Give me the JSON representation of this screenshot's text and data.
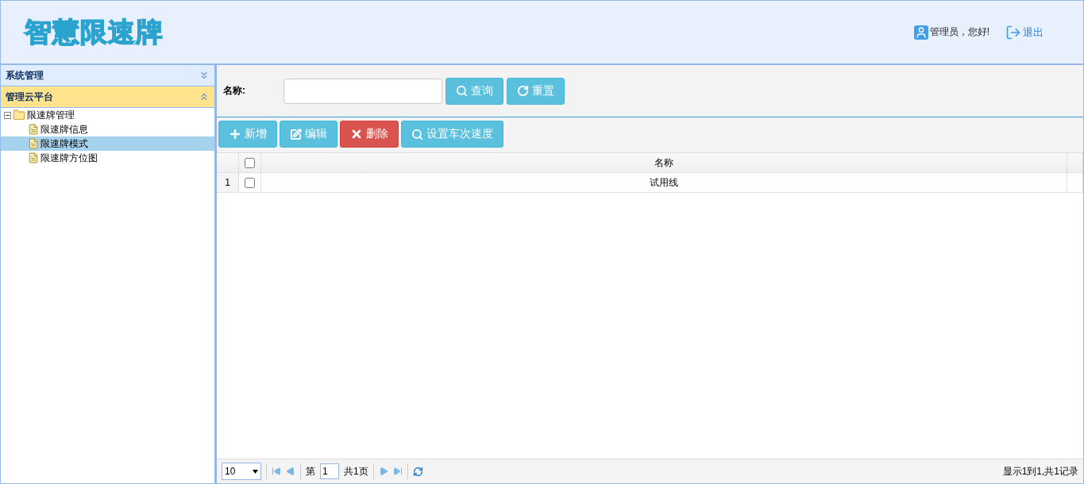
{
  "header": {
    "logo": "智慧限速牌",
    "greeting": "管理员，您好!",
    "logout": "退出"
  },
  "sidebar": {
    "panels": [
      {
        "title": "系统管理",
        "expanded": false
      },
      {
        "title": "管理云平台",
        "expanded": true,
        "tree": [
          {
            "label": "限速牌管理",
            "expanded": true,
            "children": [
              {
                "label": "限速牌信息",
                "selected": false
              },
              {
                "label": "限速牌模式",
                "selected": true
              },
              {
                "label": "限速牌方位图",
                "selected": false
              }
            ]
          }
        ]
      }
    ]
  },
  "search": {
    "label": "名称:",
    "buttons": [
      {
        "label": "查询",
        "kind": "search"
      },
      {
        "label": "重置",
        "kind": "reset"
      }
    ]
  },
  "toolbar": [
    {
      "label": "新增",
      "kind": "add"
    },
    {
      "label": "编辑",
      "kind": "edit"
    },
    {
      "label": "删除",
      "kind": "delete"
    },
    {
      "label": "设置车次速度",
      "kind": "search"
    }
  ],
  "table": {
    "all_checked": false,
    "columns": [
      "名称"
    ],
    "rows": [
      {
        "index": "1",
        "checked": false,
        "name": "试用线"
      }
    ]
  },
  "pager": {
    "page_size": "10",
    "page_prefix": "第",
    "page": "1",
    "total_pages": "共1页",
    "summary": "显示1到1,共1记录"
  }
}
